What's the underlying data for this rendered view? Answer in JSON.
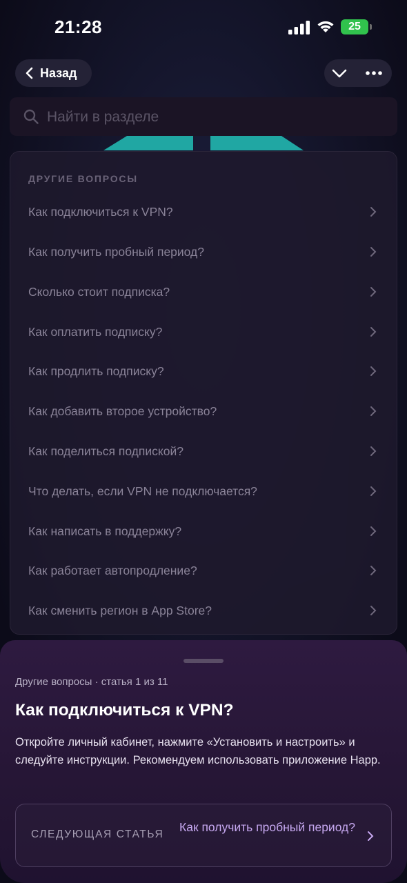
{
  "status_bar": {
    "time": "21:28",
    "battery": "25"
  },
  "nav": {
    "back_label": "Назад"
  },
  "search": {
    "placeholder": "Найти в разделе"
  },
  "faq": {
    "section_title": "ДРУГИЕ ВОПРОСЫ",
    "items": [
      {
        "label": "Как подключиться к VPN?"
      },
      {
        "label": "Как получить пробный период?"
      },
      {
        "label": "Сколько стоит подписка?"
      },
      {
        "label": "Как оплатить подписку?"
      },
      {
        "label": "Как продлить подписку?"
      },
      {
        "label": "Как добавить второе устройство?"
      },
      {
        "label": "Как поделиться подпиской?"
      },
      {
        "label": "Что делать, если VPN не подключается?"
      },
      {
        "label": "Как написать в поддержку?"
      },
      {
        "label": "Как работает автопродление?"
      },
      {
        "label": "Как сменить регион в App Store?"
      }
    ]
  },
  "sheet": {
    "meta": "Другие вопросы · статья 1 из 11",
    "title": "Как подключиться к VPN?",
    "body": "Откройте личный кабинет, нажмите «Установить и настроить» и следуйте инструкции. Рекомендуем использовать приложение Happ.",
    "next_label": "СЛЕДУЮЩАЯ СТАТЬЯ",
    "next_title": "Как получить пробный период?"
  },
  "colors": {
    "accent": "#c6a8f0",
    "teal_art": "#29a3a0",
    "battery": "#31c24d"
  },
  "icons": [
    "back-chevron-icon",
    "chevron-down-icon",
    "more-icon",
    "search-icon",
    "chevron-right-icon"
  ]
}
